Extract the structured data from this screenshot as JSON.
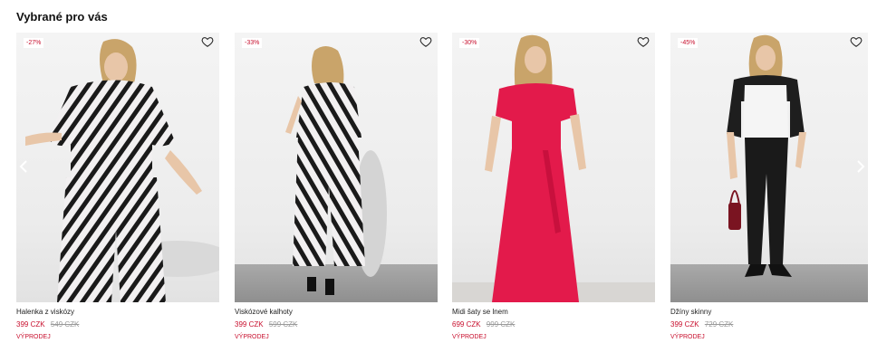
{
  "section": {
    "title": "Vybrané pro vás"
  },
  "colors": {
    "sale": "#c8102e",
    "old_price": "#9a9a9a"
  },
  "icons": {
    "favorite": "heart-icon",
    "next": "chevron-right-icon",
    "prev": "chevron-left-icon"
  },
  "products": [
    {
      "badge": "-27%",
      "name": "Halenka z viskózy",
      "price": "399 CZK",
      "old_price": "549 CZK",
      "label": "VÝPRODEJ"
    },
    {
      "badge": "-33%",
      "name": "Viskózové kalhoty",
      "price": "399 CZK",
      "old_price": "599 CZK",
      "label": "VÝPRODEJ"
    },
    {
      "badge": "-30%",
      "name": "Midi šaty se lnem",
      "price": "699 CZK",
      "old_price": "999 CZK",
      "label": "VÝPRODEJ"
    },
    {
      "badge": "-45%",
      "name": "Džíny skinny",
      "price": "399 CZK",
      "old_price": "729 CZK",
      "label": "VÝPRODEJ"
    }
  ]
}
